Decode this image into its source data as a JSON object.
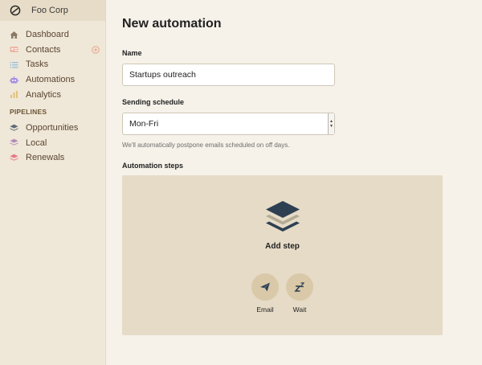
{
  "brand": {
    "name": "Foo Corp"
  },
  "sidebar": {
    "items": [
      {
        "label": "Dashboard",
        "icon": "home-icon",
        "color": "#8a7a66"
      },
      {
        "label": "Contacts",
        "icon": "contact-card-icon",
        "color": "#e9a08a"
      },
      {
        "label": "Tasks",
        "icon": "list-icon",
        "color": "#9cc3da"
      },
      {
        "label": "Automations",
        "icon": "robot-icon",
        "color": "#a48de0"
      },
      {
        "label": "Analytics",
        "icon": "bar-chart-icon",
        "color": "#e2c27a"
      }
    ],
    "pipelines_heading": "PIPELINES",
    "pipelines": [
      {
        "label": "Opportunities",
        "icon": "layers-icon",
        "color": "#5b6b77"
      },
      {
        "label": "Local",
        "icon": "layers-icon",
        "color": "#b58ab8"
      },
      {
        "label": "Renewals",
        "icon": "layers-icon",
        "color": "#e67a86"
      }
    ]
  },
  "main": {
    "title": "New automation",
    "name_label": "Name",
    "name_value": "Startups outreach",
    "schedule_label": "Sending schedule",
    "schedule_value": "Mon-Fri",
    "schedule_help": "We'll automatically postpone emails scheduled on off days.",
    "steps_label": "Automation steps",
    "add_step_label": "Add step",
    "step_options": [
      {
        "label": "Email",
        "icon": "paper-plane-icon"
      },
      {
        "label": "Wait",
        "icon": "sleep-icon"
      }
    ]
  },
  "colors": {
    "sidebar_bg": "#efe7d8",
    "page_bg": "#f6f2ea",
    "panel_bg": "#e6dbc7",
    "step_button_bg": "#d9c9a8",
    "dark_icon": "#2e3f52"
  }
}
